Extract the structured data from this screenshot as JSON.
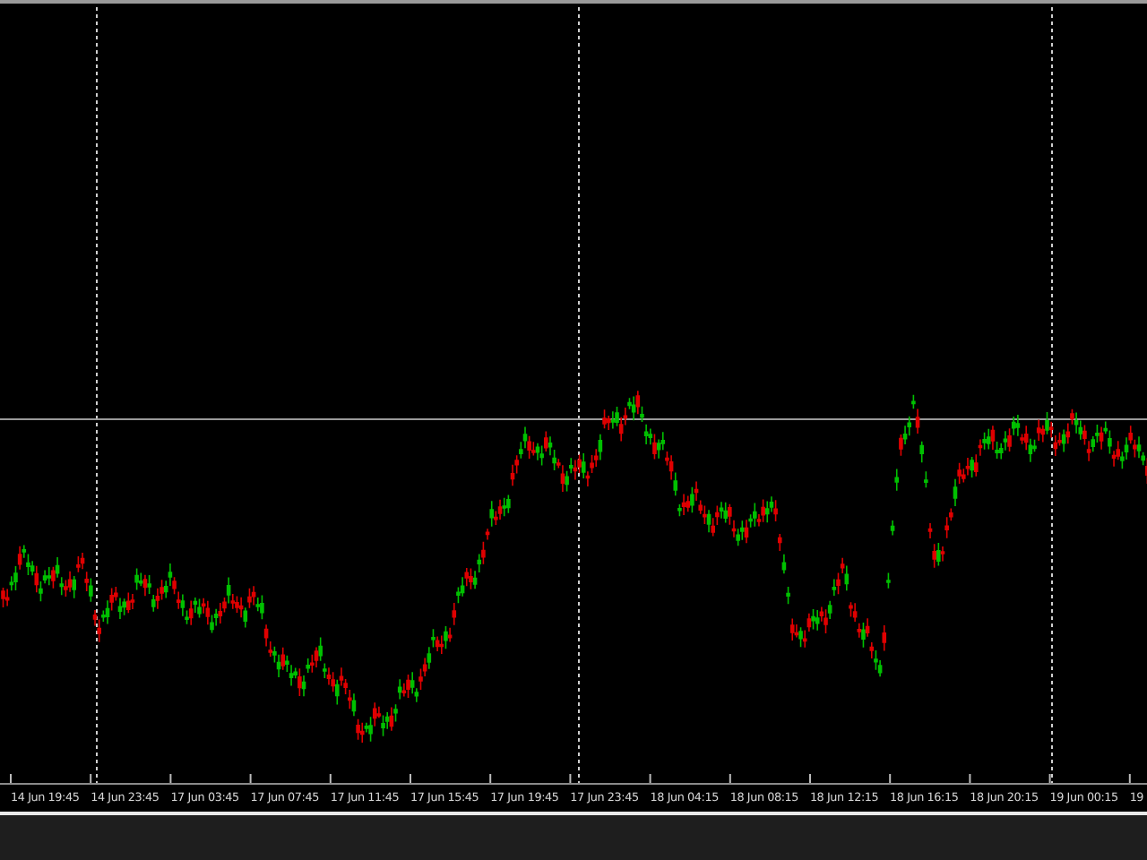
{
  "chart": {
    "time_labels": [
      "14 Jun 19:45",
      "14 Jun 23:45",
      "17 Jun 03:45",
      "17 Jun 07:45",
      "17 Jun 11:45",
      "17 Jun 15:45",
      "17 Jun 19:45",
      "17 Jun 23:45",
      "18 Jun 04:15",
      "18 Jun 08:15",
      "18 Jun 12:15",
      "18 Jun 16:15",
      "18 Jun 20:15",
      "19 Jun 00:15",
      "19"
    ]
  }
}
